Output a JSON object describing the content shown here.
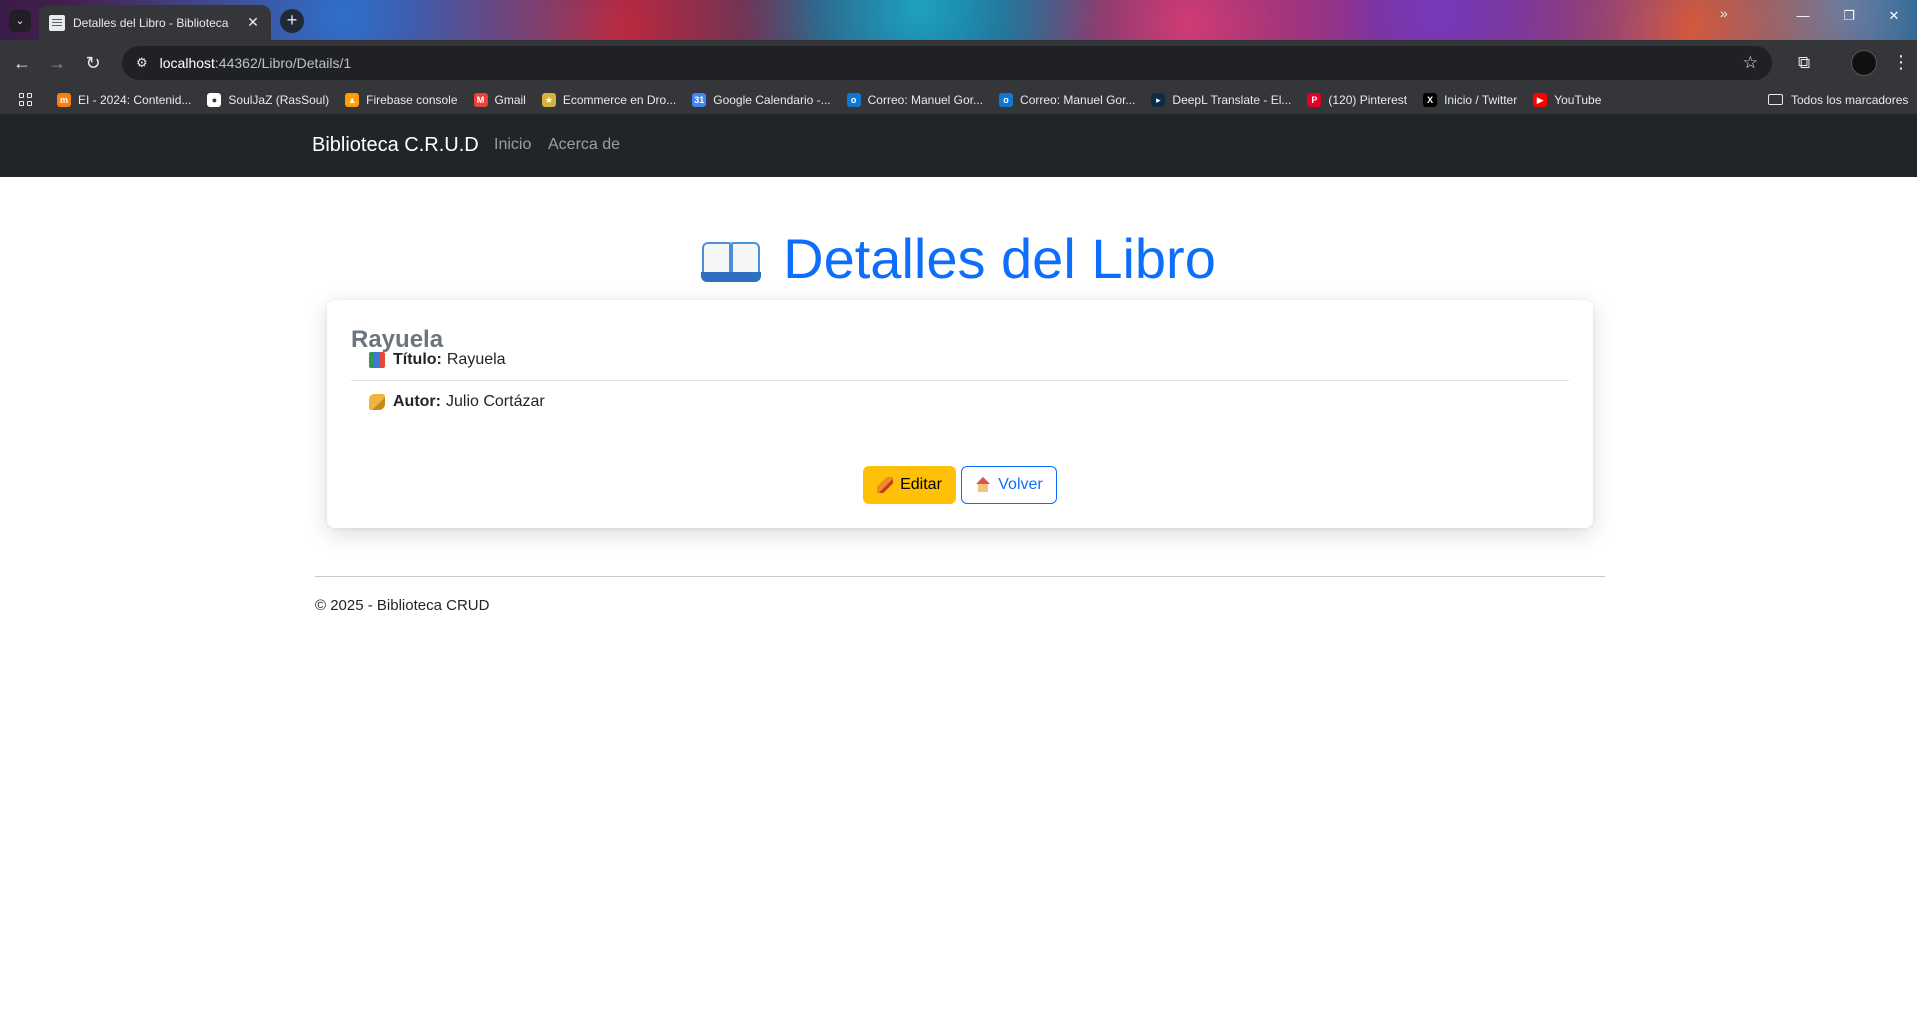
{
  "browser": {
    "tab": {
      "title": "Detalles del Libro - Biblioteca",
      "close": "✕"
    },
    "new_tab": "+",
    "window_controls": {
      "minimize": "—",
      "restore": "❐",
      "close": "✕"
    },
    "omnibox": {
      "host": "localhost",
      "path": ":44362/Libro/Details/1"
    },
    "bookmarks": [
      {
        "label": "EI - 2024: Contenid...",
        "icon": "moodle-icon",
        "color": "#f98012",
        "glyph": "m"
      },
      {
        "label": "SoulJaZ (RasSoul)",
        "icon": "github-icon",
        "color": "#ffffff",
        "glyph": "●"
      },
      {
        "label": "Firebase console",
        "icon": "firebase-icon",
        "color": "#ffa000",
        "glyph": "▲"
      },
      {
        "label": "Gmail",
        "icon": "gmail-icon",
        "color": "#ea4335",
        "glyph": "M"
      },
      {
        "label": "Ecommerce en Dro...",
        "icon": "ecommerce-icon",
        "color": "#d4b33a",
        "glyph": "★"
      },
      {
        "label": "Google Calendario -...",
        "icon": "calendar-icon",
        "color": "#4285f4",
        "glyph": "31"
      },
      {
        "label": "Correo: Manuel Gor...",
        "icon": "outlook-icon",
        "color": "#0f78d4",
        "glyph": "o"
      },
      {
        "label": "Correo: Manuel Gor...",
        "icon": "outlook-icon",
        "color": "#0f78d4",
        "glyph": "o"
      },
      {
        "label": "DeepL Translate - El...",
        "icon": "deepl-icon",
        "color": "#0f2b46",
        "glyph": "▸"
      },
      {
        "label": "(120) Pinterest",
        "icon": "pinterest-icon",
        "color": "#e60023",
        "glyph": "P"
      },
      {
        "label": "Inicio / Twitter",
        "icon": "x-twitter-icon",
        "color": "#000000",
        "glyph": "X"
      },
      {
        "label": "YouTube",
        "icon": "youtube-icon",
        "color": "#ff0000",
        "glyph": "▶"
      }
    ],
    "bookmarks_more": "»",
    "all_bookmarks": "Todos los marcadores"
  },
  "navbar": {
    "brand": "Biblioteca C.R.U.D",
    "links": [
      "Inicio",
      "Acerca de"
    ]
  },
  "page": {
    "heading": "Detalles del Libro",
    "card": {
      "title": "Rayuela",
      "fields": [
        {
          "label": "Título:",
          "value": "Rayuela",
          "icon": "books-icon"
        },
        {
          "label": "Autor:",
          "value": "Julio Cortázar",
          "icon": "writing-hand-icon"
        }
      ],
      "buttons": {
        "edit": "Editar",
        "back": "Volver"
      }
    },
    "footer": "© 2025 - Biblioteca CRUD"
  },
  "colors": {
    "primary": "#0d6efd",
    "warning": "#ffc107",
    "navbar_bg": "#212529"
  }
}
